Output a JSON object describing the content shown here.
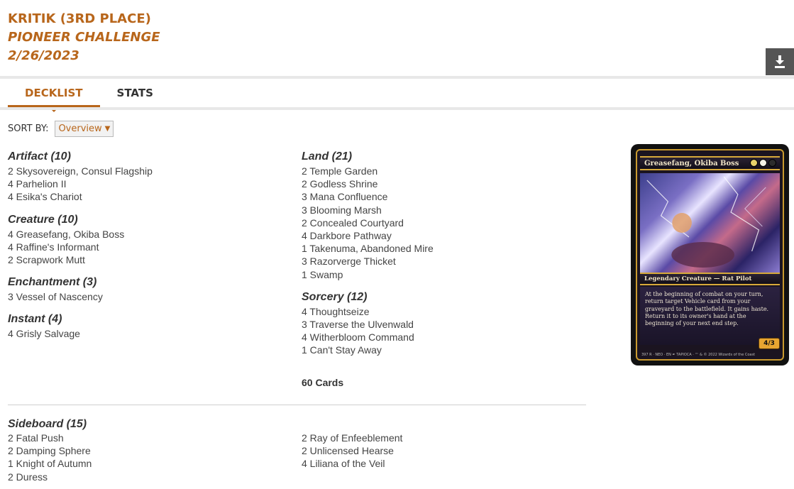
{
  "header": {
    "player": "KRITIK (3RD PLACE)",
    "event": "PIONEER CHALLENGE",
    "date": "2/26/2023"
  },
  "tabs": [
    {
      "label": "DECKLIST",
      "active": true
    },
    {
      "label": "STATS",
      "active": false
    }
  ],
  "sort": {
    "label": "SORT BY:",
    "selected": "Overview"
  },
  "maindeck": {
    "left": [
      {
        "heading": "Artifact (10)",
        "cards": [
          "2 Skysovereign, Consul Flagship",
          "4 Parhelion II",
          "4 Esika's Chariot"
        ]
      },
      {
        "heading": "Creature (10)",
        "cards": [
          "4 Greasefang, Okiba Boss",
          "4 Raffine's Informant",
          "2 Scrapwork Mutt"
        ]
      },
      {
        "heading": "Enchantment (3)",
        "cards": [
          "3 Vessel of Nascency"
        ]
      },
      {
        "heading": "Instant (4)",
        "cards": [
          "4 Grisly Salvage"
        ]
      }
    ],
    "right": [
      {
        "heading": "Land (21)",
        "cards": [
          "2 Temple Garden",
          "2 Godless Shrine",
          "3 Mana Confluence",
          "3 Blooming Marsh",
          "2 Concealed Courtyard",
          "4 Darkbore Pathway",
          "1 Takenuma, Abandoned Mire",
          "3 Razorverge Thicket",
          "1 Swamp"
        ]
      },
      {
        "heading": "Sorcery (12)",
        "cards": [
          "4 Thoughtseize",
          "3 Traverse the Ulvenwald",
          "4 Witherbloom Command",
          "1 Can't Stay Away"
        ]
      }
    ],
    "total": "60 Cards"
  },
  "sideboard": {
    "heading": "Sideboard (15)",
    "left": [
      "2 Fatal Push",
      "2 Damping Sphere",
      "1 Knight of Autumn",
      "2 Duress"
    ],
    "right": [
      "2 Ray of Enfeeblement",
      "2 Unlicensed Hearse",
      "4 Liliana of the Veil"
    ]
  },
  "card_preview": {
    "name": "Greasefang, Okiba Boss",
    "type_line": "Legendary Creature — Rat Pilot",
    "rules_text": "At the beginning of combat on your turn, return target Vehicle card from your graveyard to the battlefield. It gains haste. Return it to its owner's hand at the beginning of your next end step.",
    "pt": "4/3",
    "footer": "397 R · NEO · EN ✒ TAPIOCA · ™ & © 2022 Wizards of the Coast",
    "mana_colors": [
      "#e8d26a",
      "#f4f1e6",
      "#2c2c2c"
    ]
  },
  "icons": {
    "download": "download-icon",
    "dropdown": "chevron-down-icon"
  },
  "colors": {
    "accent": "#b8661b",
    "dark_button": "#555555"
  }
}
